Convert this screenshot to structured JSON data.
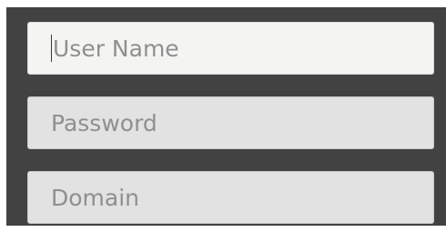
{
  "login_form": {
    "username": {
      "placeholder": "User Name",
      "value": ""
    },
    "password": {
      "placeholder": "Password",
      "value": ""
    },
    "domain": {
      "placeholder": "Domain",
      "value": ""
    }
  },
  "colors": {
    "panel_background": "#424242",
    "field_background": "#e2e2e2",
    "focused_field_background": "#f4f5f2",
    "placeholder_text": "#8f8f8f"
  }
}
